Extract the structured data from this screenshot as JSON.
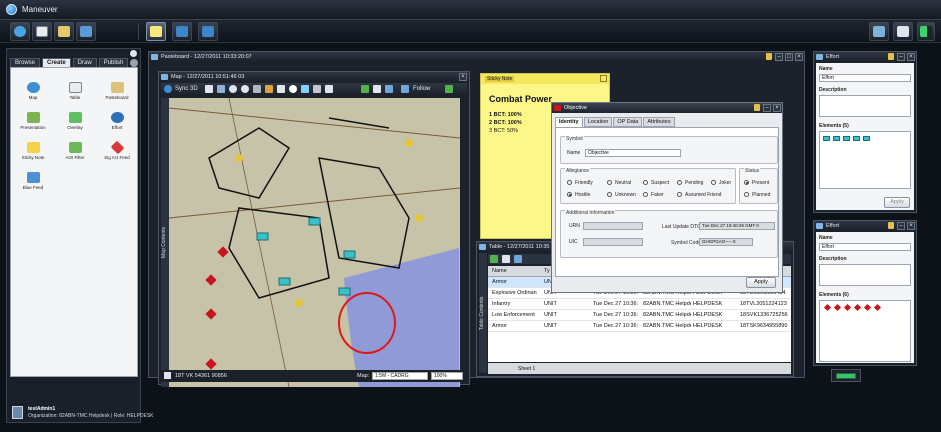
{
  "app": {
    "title": "Maneuver"
  },
  "colors": {
    "accent": "#7fb6e6",
    "map_land": "#c7c3a8",
    "map_water": "#8f9ad6",
    "sticky": "#fdf78a",
    "hostile_red": "#c8141c",
    "unit_cyan": "#39c1c9"
  },
  "toolbar": {
    "left_icons": [
      "globe-icon",
      "table-icon",
      "paste-icon",
      "user-upload-icon"
    ],
    "center_icons": [
      "sticky-note-icon",
      "workspace-icon",
      "workspace-icon"
    ],
    "right_icons": [
      "trash-icon",
      "mail-icon",
      "signal-icon"
    ]
  },
  "palette": {
    "tabs": [
      "Browse",
      "Create",
      "Draw",
      "Publish"
    ],
    "active_tab": "Create",
    "items": [
      {
        "label": "Map",
        "icon": "globe-icon"
      },
      {
        "label": "Table",
        "icon": "table-icon"
      },
      {
        "label": "Pasteboard",
        "icon": "paste-icon"
      },
      {
        "label": "Presentation",
        "icon": "presentation-icon"
      },
      {
        "label": "Overlay",
        "icon": "overlay-icon"
      },
      {
        "label": "Effort",
        "icon": "effort-icon"
      },
      {
        "label": "Sticky Note",
        "icon": "sticky-note-icon"
      },
      {
        "label": "AOI Filter",
        "icon": "filter-icon"
      },
      {
        "label": "Sig Act Feed",
        "icon": "feed-icon"
      },
      {
        "label": "Blue Feed",
        "icon": "blue-feed-icon"
      }
    ]
  },
  "user": {
    "name": "testAdmin1",
    "org_line": "Organization: 82ABN-TMC Helpdesk | Role: HELPDESK"
  },
  "pasteboard": {
    "title": "Pasteboard - 12/27/2011 10:33:20:07"
  },
  "map": {
    "title": "Map - 12/27/2011 10:51:46 03",
    "sync_label": "Sync 3D",
    "follow_label": "Follow",
    "side_label": "Map Contents",
    "coord": "18T VK 54361 90856",
    "map_label": "Map:",
    "map_select": "1:5M - CADRG",
    "zoom": "100%"
  },
  "sticky": {
    "header": "Sticky Note",
    "title": "Combat Power",
    "lines": [
      "1 BCT: 100%",
      "2 BCT: 100%",
      "3 BCT: 50%"
    ]
  },
  "objective": {
    "title": "Objective",
    "tabs": [
      "Identity",
      "Location",
      "OP Data",
      "Attributes"
    ],
    "symbol_legend": "Symbol",
    "name_label": "Name",
    "name_value": "Objective",
    "allegiance_legend": "Allegiance",
    "allegiance_options": [
      "Friendly",
      "Neutral",
      "Suspect",
      "Pending",
      "Joker",
      "Hostile",
      "Unknown",
      "Faker",
      "Assumed Friend"
    ],
    "allegiance_selected": "Hostile",
    "status_legend": "Status",
    "status_options": [
      "Present",
      "Planned"
    ],
    "status_selected": "Present",
    "addl_legend": "Additional Information",
    "urn_label": "URN",
    "uic_label": "UIC",
    "last_update_label": "Last Update DTG",
    "last_update_value": "Tue Dec 27 10:40:49 GMT-0",
    "symbol_code_label": "Symbol Code",
    "symbol_code_value": "GHGPGAO-----X",
    "apply_label": "Apply"
  },
  "table": {
    "title": "Table - 12/27/2011 10:35",
    "side_label": "Table Contents",
    "columns": [
      "Name",
      "Ty",
      "",
      "",
      "",
      ""
    ],
    "rows": [
      [
        "Armor",
        "UN",
        "",
        "",
        "",
        ""
      ],
      [
        "Explosive Ordinan",
        "UNIT",
        "Tue Dec 27 10:36:",
        "82ABN.TMC Helpdesk",
        "HELPDESK",
        "18TUM561951484"
      ],
      [
        "Infantry",
        "UNIT",
        "Tue Dec 27 10:36:",
        "82ABN.TMC Helpdesk",
        "HELPDESK",
        "18TVL2051224123"
      ],
      [
        "Low Enforcement",
        "UNIT",
        "Tue Dec 27 10:36:",
        "82ABN.TMC Helpdesk",
        "HELPDESK",
        "18SVK1336725256"
      ],
      [
        "Armor",
        "UNIT",
        "Tue Dec 27 10:36:",
        "82ABN.TMC Helpdesk",
        "HELPDESK",
        "18TSK9634955890"
      ]
    ],
    "sheet_label": "Sheet 1"
  },
  "effort1": {
    "title": "Effort",
    "name_label": "Name",
    "name_value": "Effort",
    "desc_label": "Description",
    "elements_label": "Elements (5)",
    "element_count": 5,
    "apply_label": "Apply"
  },
  "effort2": {
    "title": "Effort",
    "name_label": "Name",
    "name_value": "Effort",
    "desc_label": "Description",
    "elements_label": "Elements (6)",
    "element_count": 6
  }
}
